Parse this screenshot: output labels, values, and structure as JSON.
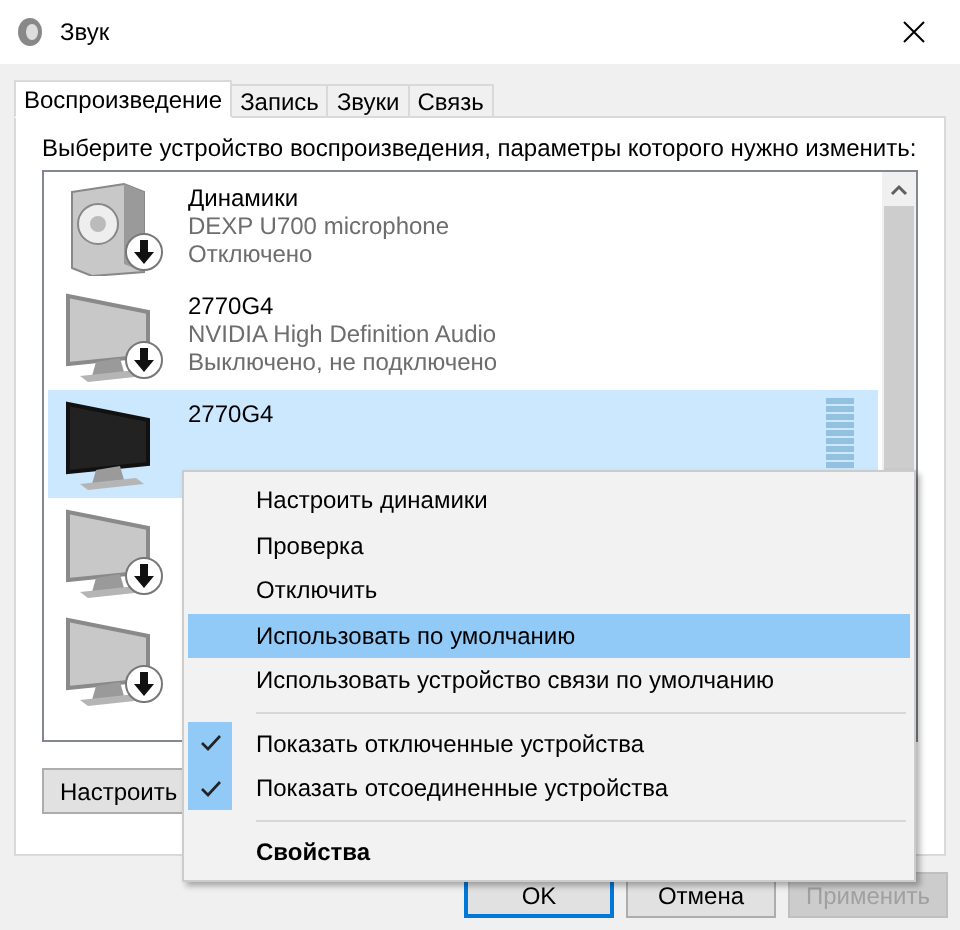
{
  "window": {
    "title": "Звук"
  },
  "tabs": [
    {
      "label": "Воспроизведение",
      "selected": true
    },
    {
      "label": "Запись",
      "selected": false
    },
    {
      "label": "Звуки",
      "selected": false
    },
    {
      "label": "Связь",
      "selected": false
    }
  ],
  "instruction": "Выберите устройство воспроизведения, параметры которого нужно изменить:",
  "devices": [
    {
      "kind": "speaker",
      "name": "Динамики",
      "description": "DEXP U700 microphone",
      "status": "Отключено",
      "disabled": true,
      "selected": false
    },
    {
      "kind": "monitor",
      "name": "2770G4",
      "description": "NVIDIA High Definition Audio",
      "status": "Выключено, не подключено",
      "disabled": true,
      "selected": false
    },
    {
      "kind": "monitor",
      "name": "2770G4",
      "disabled": false,
      "selected": true
    },
    {
      "kind": "monitor",
      "disabled": true,
      "selected": false
    },
    {
      "kind": "monitor",
      "disabled": true,
      "selected": false
    }
  ],
  "panel_buttons": [
    "Настроить"
  ],
  "context_menu": [
    {
      "kind": "item",
      "label": "Настроить динамики",
      "checked": false,
      "selected": false
    },
    {
      "kind": "item",
      "label": "Проверка",
      "checked": false,
      "selected": false
    },
    {
      "kind": "item",
      "label": "Отключить",
      "checked": false,
      "selected": false
    },
    {
      "kind": "item",
      "label": "Использовать по умолчанию",
      "checked": false,
      "selected": true
    },
    {
      "kind": "item",
      "label": "Использовать устройство связи по умолчанию",
      "checked": false,
      "selected": false
    },
    {
      "kind": "separator"
    },
    {
      "kind": "item",
      "label": "Показать отключенные устройства",
      "checked": true,
      "selected": false
    },
    {
      "kind": "item",
      "label": "Показать отсоединенные устройства",
      "checked": true,
      "selected": false
    },
    {
      "kind": "separator"
    },
    {
      "kind": "default",
      "label": "Свойства",
      "checked": false,
      "selected": false
    }
  ],
  "dialog_buttons": [
    {
      "label": "OK",
      "kind": "default",
      "disabled": false
    },
    {
      "label": "Отмена",
      "kind": "normal",
      "disabled": false
    },
    {
      "label": "Применить",
      "kind": "normal",
      "disabled": true
    }
  ]
}
